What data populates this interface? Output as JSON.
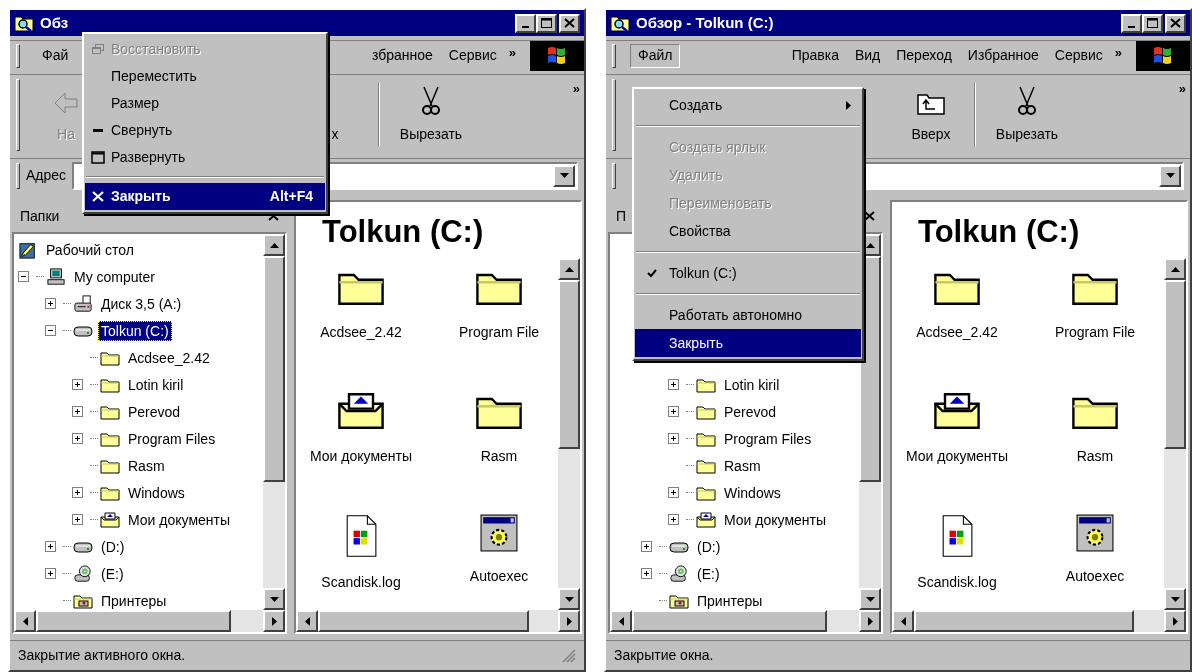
{
  "windows": [
    {
      "title": "Обз",
      "menu_bar": [
        {
          "label": "Фай",
          "selected": false
        },
        {
          "label": "збранное",
          "selected": false
        },
        {
          "label": "Сервис",
          "selected": false
        }
      ],
      "menu_chevron": "»",
      "toolbar": [
        {
          "kind": "back",
          "label": "На",
          "disabled": true
        },
        {
          "kind": "text",
          "label": "х",
          "disabled": false
        },
        {
          "kind": "cut",
          "label": "Вырезать",
          "disabled": false
        }
      ],
      "toolbar_chevron": "»",
      "address": {
        "label": "Адрес"
      },
      "folders_pane": {
        "title": "Папки",
        "tree": [
          {
            "kind": "desktop",
            "label": "Рабочий стол",
            "selected": false,
            "children": [
              {
                "kind": "computer",
                "label": "My computer",
                "selected": false,
                "expanded": true,
                "children": [
                  {
                    "kind": "floppy",
                    "label": "Диск 3,5 (A:)",
                    "selected": false,
                    "expanded": false
                  },
                  {
                    "kind": "drive",
                    "label": "Tolkun (C:)",
                    "selected": true,
                    "expanded": true,
                    "children": [
                      {
                        "kind": "folder",
                        "label": "Acdsee_2.42",
                        "selected": false
                      },
                      {
                        "kind": "folder",
                        "label": "Lotin kiril",
                        "selected": false,
                        "expanded": false
                      },
                      {
                        "kind": "folder",
                        "label": "Perevod",
                        "selected": false,
                        "expanded": false
                      },
                      {
                        "kind": "folder",
                        "label": "Program Files",
                        "selected": false,
                        "expanded": false
                      },
                      {
                        "kind": "folder",
                        "label": "Rasm",
                        "selected": false
                      },
                      {
                        "kind": "folder",
                        "label": "Windows",
                        "selected": false,
                        "expanded": false
                      },
                      {
                        "kind": "documents",
                        "label": "Мои документы",
                        "selected": false,
                        "expanded": false
                      }
                    ]
                  },
                  {
                    "kind": "drive",
                    "label": "(D:)",
                    "selected": false,
                    "expanded": false
                  },
                  {
                    "kind": "cdrom",
                    "label": "(E:)",
                    "selected": false,
                    "expanded": false
                  },
                  {
                    "kind": "printers",
                    "label": "Принтеры",
                    "selected": false
                  }
                ]
              }
            ]
          }
        ]
      },
      "content": {
        "heading": "Tolkun (C:)",
        "items": [
          {
            "kind": "folder",
            "label": "Acdsee_2.42"
          },
          {
            "kind": "folder",
            "label": "Program File"
          },
          {
            "kind": "documents",
            "label": "Мои документы"
          },
          {
            "kind": "folder",
            "label": "Rasm"
          },
          {
            "kind": "log",
            "label": "Scandisk.log"
          },
          {
            "kind": "system",
            "label": "Autoexec"
          }
        ]
      },
      "status_bar": {
        "text": "Закрытие активного окна.",
        "resize_grip": true
      },
      "popup": {
        "kind": "system",
        "items": [
          {
            "kind": "restore",
            "label": "Восстановить",
            "disabled": true,
            "selected": false,
            "default": false
          },
          {
            "kind": "plain",
            "label": "Переместить",
            "disabled": false,
            "selected": false,
            "default": false
          },
          {
            "kind": "plain",
            "label": "Размер",
            "disabled": false,
            "selected": false,
            "default": false
          },
          {
            "kind": "minimize",
            "label": "Свернуть",
            "disabled": false,
            "selected": false,
            "default": false
          },
          {
            "kind": "maximize",
            "label": "Развернуть",
            "disabled": false,
            "selected": false,
            "default": false
          },
          {
            "kind": "separator"
          },
          {
            "kind": "close",
            "label": "Закрыть",
            "shortcut": "Alt+F4",
            "disabled": false,
            "selected": true,
            "default": true
          }
        ]
      }
    },
    {
      "title": "Обзор - Tolkun (C:)",
      "menu_bar": [
        {
          "label": "Файл",
          "selected": true
        },
        {
          "label": "Правка",
          "selected": false
        },
        {
          "label": "Вид",
          "selected": false
        },
        {
          "label": "Переход",
          "selected": false
        },
        {
          "label": "Избранное",
          "selected": false
        },
        {
          "label": "Сервис",
          "selected": false
        }
      ],
      "menu_chevron": "»",
      "toolbar": [
        {
          "kind": "up",
          "label": "Вверх",
          "disabled": false
        },
        {
          "kind": "cut",
          "label": "Вырезать",
          "disabled": false
        }
      ],
      "toolbar_chevron": "»",
      "folders_pane": {
        "title": "П",
        "tree": [
          {
            "kind": "covered",
            "children": [
              {
                "kind": "covered",
                "children": [
                  {
                    "kind": "covered"
                  },
                  {
                    "kind": "covered",
                    "children": [
                      {
                        "kind": "covered"
                      },
                      {
                        "kind": "folder",
                        "label": "Lotin kiril",
                        "selected": false,
                        "expanded": false
                      },
                      {
                        "kind": "folder",
                        "label": "Perevod",
                        "selected": false,
                        "expanded": false
                      },
                      {
                        "kind": "folder",
                        "label": "Program Files",
                        "selected": false,
                        "expanded": false
                      },
                      {
                        "kind": "folder",
                        "label": "Rasm",
                        "selected": false
                      },
                      {
                        "kind": "folder",
                        "label": "Windows",
                        "selected": false,
                        "expanded": false
                      },
                      {
                        "kind": "documents",
                        "label": "Мои документы",
                        "selected": false,
                        "expanded": false
                      }
                    ]
                  },
                  {
                    "kind": "drive",
                    "label": "(D:)",
                    "selected": false,
                    "expanded": false
                  },
                  {
                    "kind": "cdrom",
                    "label": "(E:)",
                    "selected": false,
                    "expanded": false
                  },
                  {
                    "kind": "printers",
                    "label": "Принтеры",
                    "selected": false
                  }
                ]
              }
            ]
          }
        ]
      },
      "content": {
        "heading": "Tolkun (C:)",
        "items": [
          {
            "kind": "folder",
            "label": "Acdsee_2.42"
          },
          {
            "kind": "folder",
            "label": "Program File"
          },
          {
            "kind": "documents",
            "label": "Мои документы"
          },
          {
            "kind": "folder",
            "label": "Rasm"
          },
          {
            "kind": "log",
            "label": "Scandisk.log"
          },
          {
            "kind": "system",
            "label": "Autoexec"
          }
        ]
      },
      "status_bar": {
        "text": "Закрытие окна.",
        "resize_grip": false
      },
      "popup": {
        "kind": "file",
        "items": [
          {
            "kind": "item",
            "label": "Создать",
            "disabled": false,
            "selected": false,
            "checked": false,
            "submenu": true
          },
          {
            "kind": "separator"
          },
          {
            "kind": "item",
            "label": "Создать ярлык",
            "disabled": true,
            "selected": false,
            "checked": false,
            "submenu": false
          },
          {
            "kind": "item",
            "label": "Удалить",
            "disabled": true,
            "selected": false,
            "checked": false,
            "submenu": false
          },
          {
            "kind": "item",
            "label": "Переименовать",
            "disabled": true,
            "selected": false,
            "checked": false,
            "submenu": false
          },
          {
            "kind": "item",
            "label": "Свойства",
            "disabled": false,
            "selected": false,
            "checked": false,
            "submenu": false
          },
          {
            "kind": "separator"
          },
          {
            "kind": "item",
            "label": "Tolkun (C:)",
            "disabled": false,
            "selected": false,
            "checked": true,
            "submenu": false
          },
          {
            "kind": "separator"
          },
          {
            "kind": "item",
            "label": "Работать автономно",
            "disabled": false,
            "selected": false,
            "checked": false,
            "submenu": false
          },
          {
            "kind": "item",
            "label": "Закрыть",
            "disabled": false,
            "selected": true,
            "checked": false,
            "submenu": false
          }
        ]
      }
    }
  ]
}
